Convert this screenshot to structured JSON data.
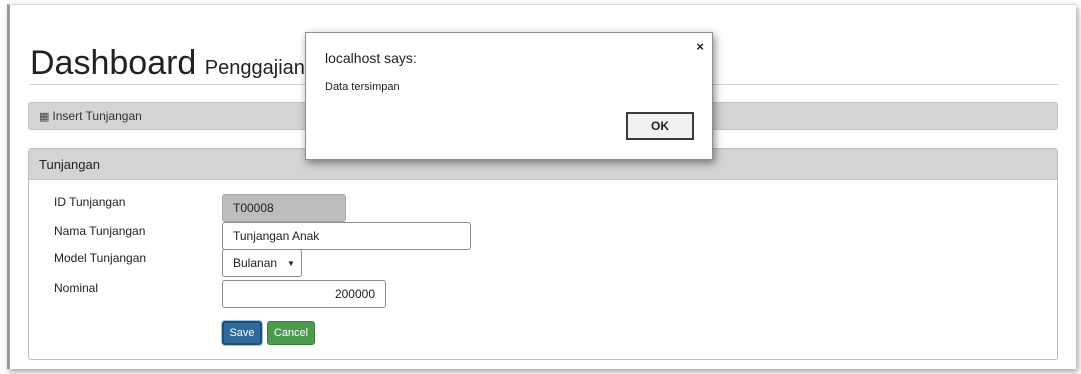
{
  "header": {
    "title": "Dashboard",
    "subtitle": "Penggajian"
  },
  "breadcrumb": {
    "icon": "table-icon",
    "label": "Insert Tunjangan"
  },
  "panel": {
    "heading": "Tunjangan"
  },
  "form": {
    "id_label": "ID Tunjangan",
    "id_value": "T00008",
    "nama_label": "Nama Tunjangan",
    "nama_value": "Tunjangan Anak",
    "model_label": "Model Tunjangan",
    "model_value": "Bulanan",
    "nominal_label": "Nominal",
    "nominal_value": "200000",
    "save_label": "Save",
    "cancel_label": "Cancel"
  },
  "dialog": {
    "title": "localhost says:",
    "message": "Data tersimpan",
    "ok_label": "OK",
    "close_glyph": "×"
  },
  "colors": {
    "save": "#2f6a9c",
    "cancel": "#4c9a4f",
    "panel_bar": "#d4d4d4",
    "readonly_field": "#bdbdbd"
  }
}
